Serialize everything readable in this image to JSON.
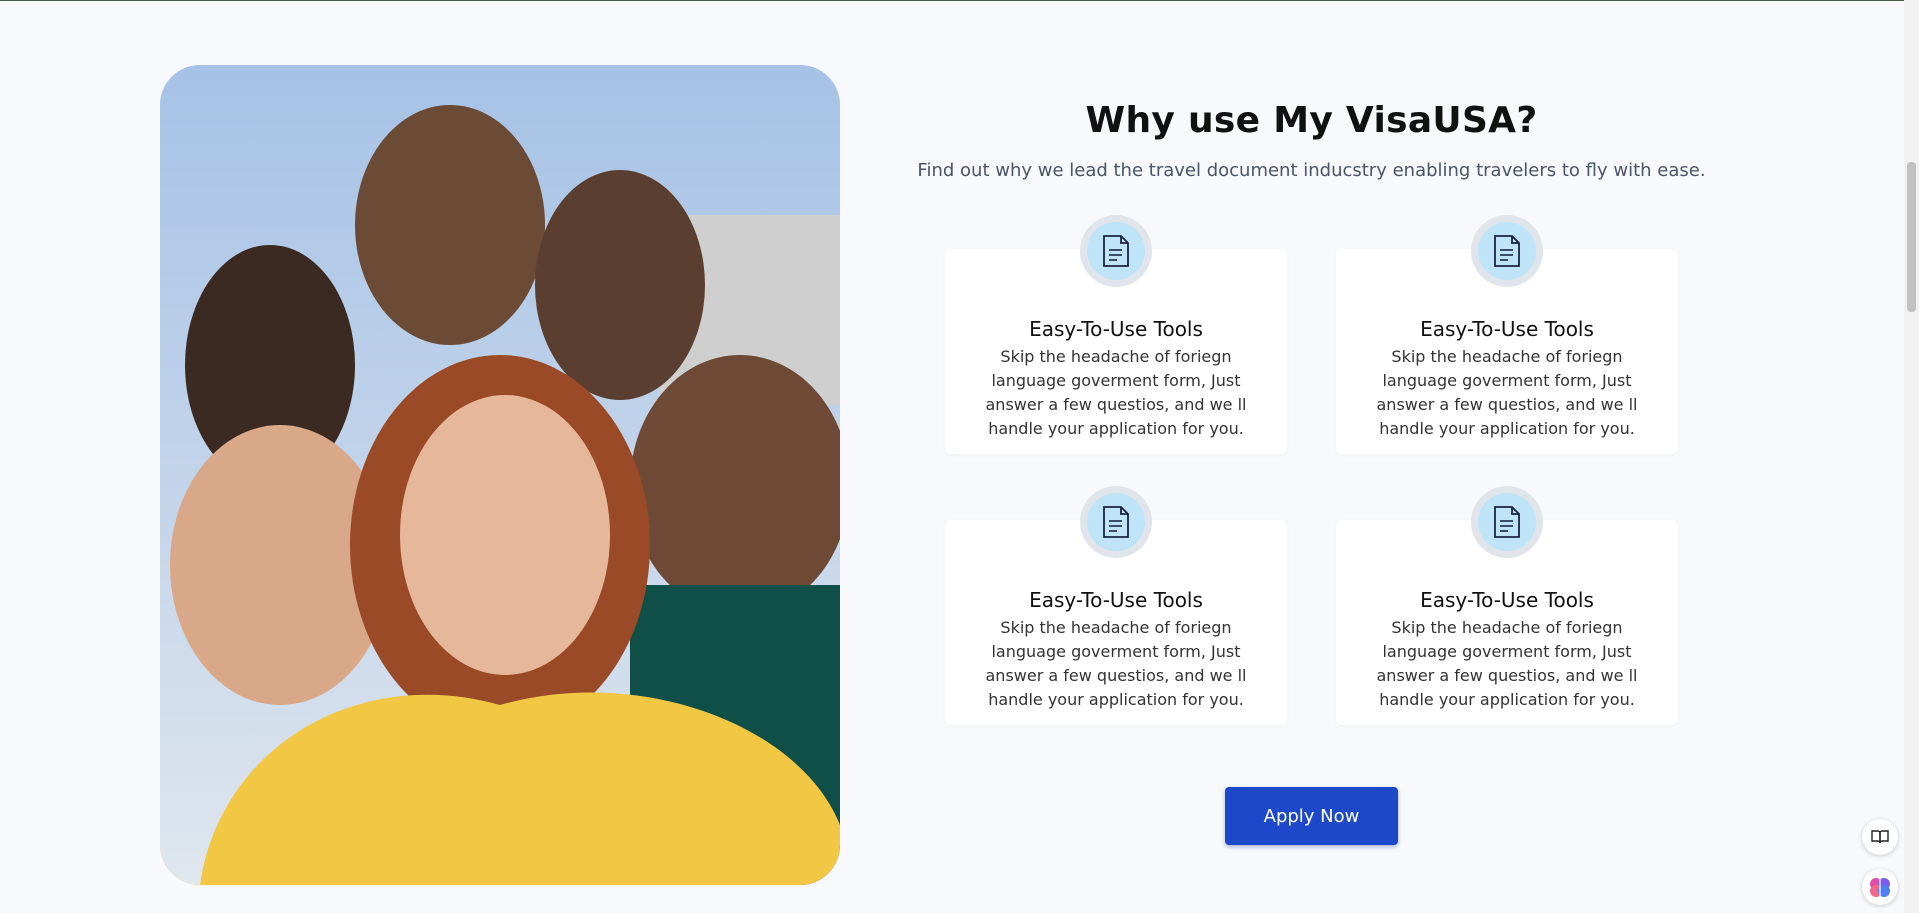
{
  "section": {
    "title": "Why use My VisaUSA?",
    "subtitle": "Find out why we lead the travel document inducstry enabling travelers to fly with ease."
  },
  "features": [
    {
      "icon": "document-icon",
      "title": "Easy-To-Use Tools",
      "text": "Skip the headache of foriegn language goverment form, Just answer a few questios, and we ll handle your application for you."
    },
    {
      "icon": "document-icon",
      "title": "Easy-To-Use Tools",
      "text": "Skip the headache of foriegn language goverment form, Just answer a few questios, and we ll handle your application for you."
    },
    {
      "icon": "document-icon",
      "title": "Easy-To-Use Tools",
      "text": "Skip the headache of foriegn language goverment form, Just answer a few questios, and we ll handle your application for you."
    },
    {
      "icon": "document-icon",
      "title": "Easy-To-Use Tools",
      "text": "Skip the headache of foriegn language goverment form, Just answer a few questios, and we ll handle your application for you."
    }
  ],
  "cta": {
    "label": "Apply Now"
  },
  "photo": {
    "subject": "group-selfie"
  },
  "widgets": [
    {
      "icon": "reader-icon"
    },
    {
      "icon": "assistant-icon"
    }
  ],
  "colors": {
    "accent": "#1d48c9",
    "background": "#f7f9fc",
    "icon_bg": "#bfe3f7",
    "text_muted": "#4a5568"
  }
}
